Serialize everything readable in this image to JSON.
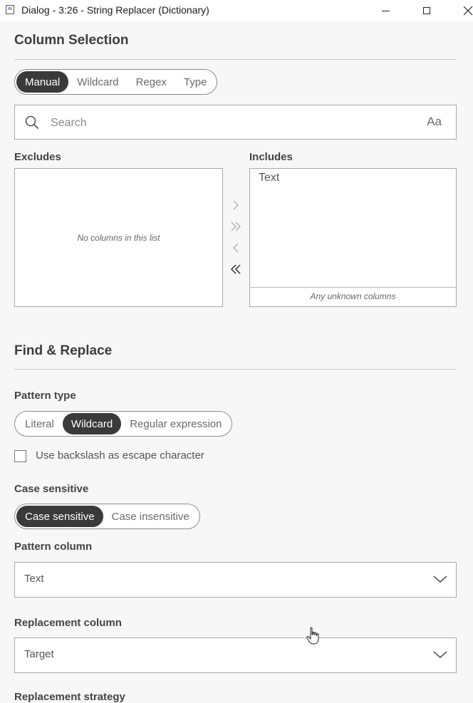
{
  "window": {
    "title": "Dialog - 3:26 - String Replacer (Dictionary)",
    "minimize_icon": "minimize-icon",
    "maximize_icon": "maximize-icon",
    "close_icon": "close-icon"
  },
  "column_selection": {
    "title": "Column Selection",
    "modes": [
      "Manual",
      "Wildcard",
      "Regex",
      "Type"
    ],
    "selected_mode": "Manual",
    "search": {
      "placeholder": "Search",
      "value": "",
      "case_toggle_label": "Aa"
    },
    "excludes": {
      "label": "Excludes",
      "items": [],
      "empty_message": "No columns in this list"
    },
    "includes": {
      "label": "Includes",
      "items": [
        "Text"
      ],
      "unknown_columns_label": "Any unknown columns"
    },
    "transfer_buttons": [
      "move-right",
      "move-all-right",
      "move-left",
      "move-all-left"
    ]
  },
  "find_replace": {
    "title": "Find & Replace",
    "pattern_type": {
      "label": "Pattern type",
      "options": [
        "Literal",
        "Wildcard",
        "Regular expression"
      ],
      "selected": "Wildcard"
    },
    "escape_checkbox": {
      "label": "Use backslash as escape character",
      "checked": false
    },
    "case_sensitive": {
      "label": "Case sensitive",
      "options": [
        "Case sensitive",
        "Case insensitive"
      ],
      "selected": "Case sensitive"
    },
    "pattern_column": {
      "label": "Pattern column",
      "value": "Text"
    },
    "replacement_column": {
      "label": "Replacement column",
      "value": "Target"
    },
    "next_label": "Replacement strategy"
  },
  "colors": {
    "active_segment": "#3a3a3a",
    "background": "#f7f7f7",
    "border": "#a8a8a8"
  }
}
